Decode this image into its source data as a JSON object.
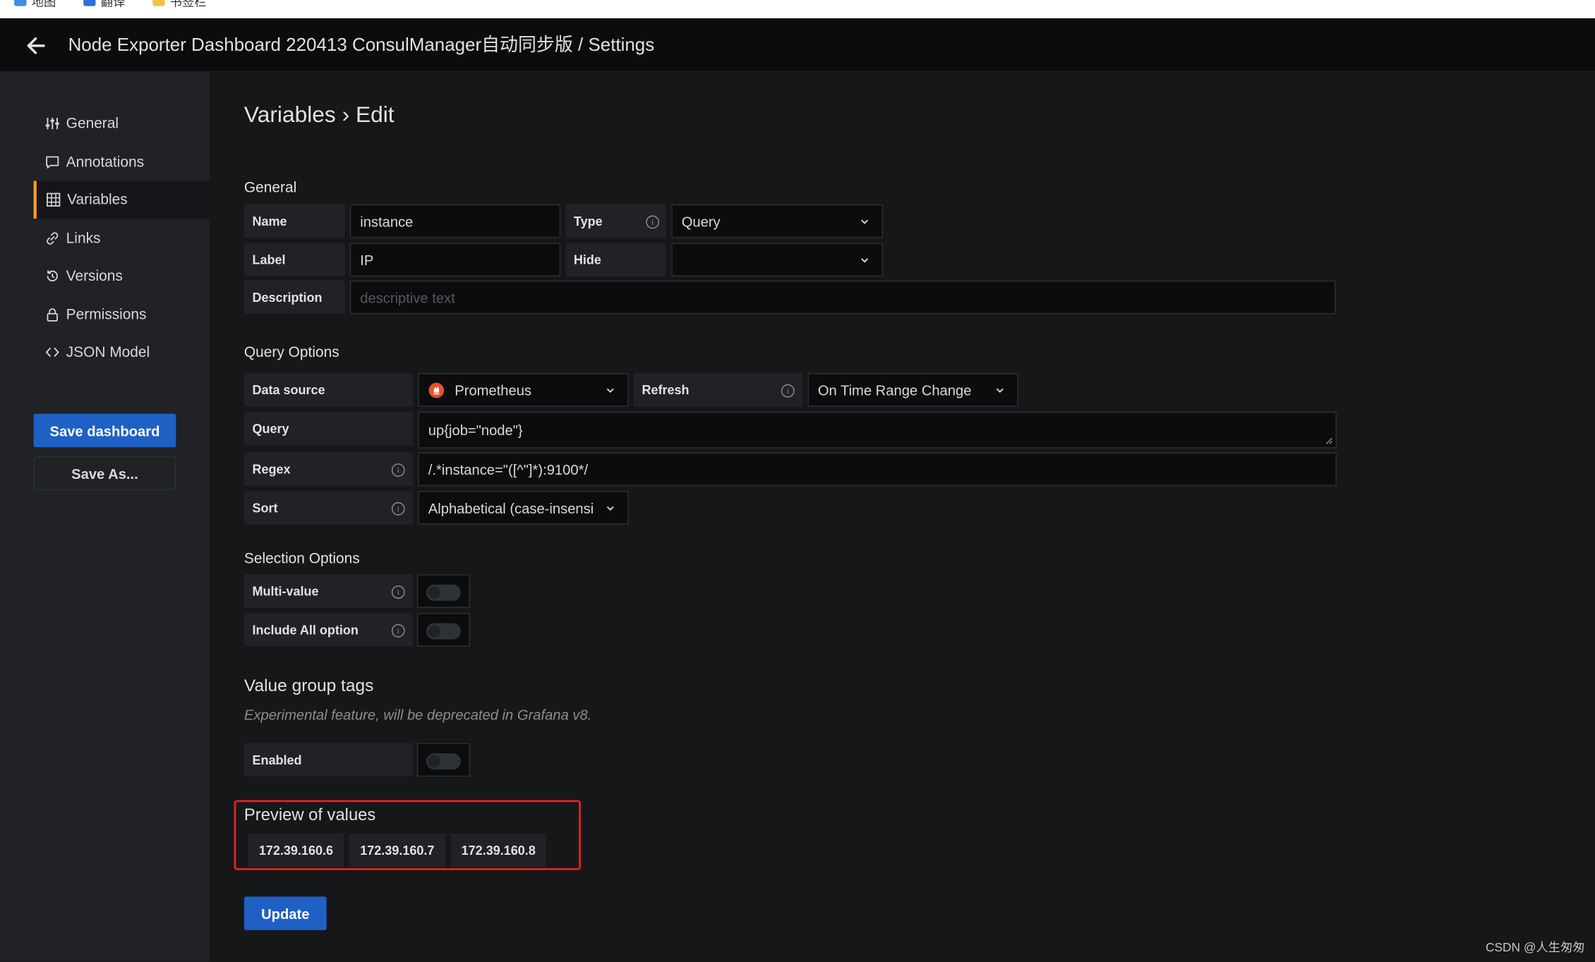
{
  "bookmarks": [
    {
      "label": "地图",
      "color": "#3a8ee6"
    },
    {
      "label": "翻译",
      "color": "#2f6fd8"
    },
    {
      "label": "书签栏",
      "color": "#f3c14b"
    }
  ],
  "topnav": {
    "title": "Node Exporter Dashboard 220413 ConsulManager自动同步版 / Settings"
  },
  "sidebar": {
    "items": [
      {
        "label": "General",
        "icon": "sliders-icon"
      },
      {
        "label": "Annotations",
        "icon": "comment-icon"
      },
      {
        "label": "Variables",
        "icon": "table-icon",
        "active": true
      },
      {
        "label": "Links",
        "icon": "link-icon"
      },
      {
        "label": "Versions",
        "icon": "history-icon"
      },
      {
        "label": "Permissions",
        "icon": "lock-icon"
      },
      {
        "label": "JSON Model",
        "icon": "code-icon"
      }
    ],
    "save_dashboard": "Save dashboard",
    "save_as": "Save As..."
  },
  "page": {
    "title": "Variables › Edit"
  },
  "general": {
    "heading": "General",
    "name_label": "Name",
    "name_value": "instance",
    "type_label": "Type",
    "type_value": "Query",
    "label_label": "Label",
    "label_value": "IP",
    "hide_label": "Hide",
    "hide_value": "",
    "description_label": "Description",
    "description_placeholder": "descriptive text"
  },
  "query_options": {
    "heading": "Query Options",
    "datasource_label": "Data source",
    "datasource_value": "Prometheus",
    "refresh_label": "Refresh",
    "refresh_value": "On Time Range Change",
    "query_label": "Query",
    "query_value": "up{job=\"node\"}",
    "regex_label": "Regex",
    "regex_value": "/.*instance=\"([^\"]*):9100*/",
    "sort_label": "Sort",
    "sort_value": "Alphabetical (case-insensi"
  },
  "selection_options": {
    "heading": "Selection Options",
    "multi_value_label": "Multi-value",
    "multi_value": false,
    "include_all_label": "Include All option",
    "include_all": false
  },
  "value_group_tags": {
    "heading": "Value group tags",
    "note": "Experimental feature, will be deprecated in Grafana v8.",
    "enabled_label": "Enabled",
    "enabled": false
  },
  "preview": {
    "heading": "Preview of values",
    "values": [
      "172.39.160.6",
      "172.39.160.7",
      "172.39.160.8"
    ]
  },
  "update_button": "Update",
  "watermark": "CSDN @人生匆匆",
  "colors": {
    "primary": "#1f60c4",
    "active_accent": "#f59c30",
    "highlight_box": "#e12222"
  }
}
